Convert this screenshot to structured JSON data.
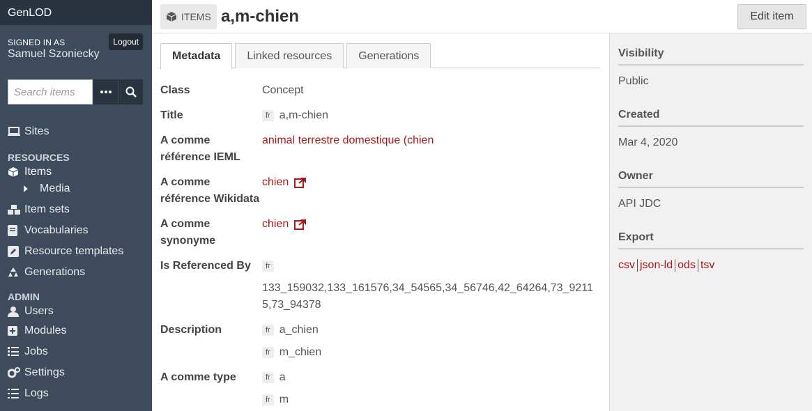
{
  "app": {
    "brand": "GenLOD"
  },
  "user": {
    "signed_in_label": "SIGNED IN AS",
    "name": "Samuel Szoniecky",
    "logout_label": "Logout"
  },
  "search": {
    "placeholder": "Search items"
  },
  "nav": {
    "sites": "Sites",
    "resources_header": "RESOURCES",
    "items": "Items",
    "media": "Media",
    "item_sets": "Item sets",
    "vocabularies": "Vocabularies",
    "resource_templates": "Resource templates",
    "generations": "Generations",
    "admin_header": "ADMIN",
    "users": "Users",
    "modules": "Modules",
    "jobs": "Jobs",
    "settings": "Settings",
    "logs": "Logs"
  },
  "header": {
    "crumb": "ITEMS",
    "title": "a,m-chien",
    "edit_label": "Edit item"
  },
  "tabs": [
    "Metadata",
    "Linked resources",
    "Generations"
  ],
  "props": {
    "class": {
      "label": "Class",
      "value": "Concept"
    },
    "title": {
      "label": "Title",
      "lang": "fr",
      "value": "a,m-chien"
    },
    "ieml": {
      "label": "A comme référence IEML",
      "value": "animal terrestre domestique (chien"
    },
    "wikidata": {
      "label": "A comme référence Wikidata",
      "value": "chien"
    },
    "synonyme": {
      "label": "A comme synonyme",
      "value": "chien"
    },
    "referenced": {
      "label": "Is Referenced By",
      "lang": "fr",
      "value": "133_159032,133_161576,34_54565,34_56746,42_64264,73_92115,73_94378"
    },
    "description": {
      "label": "Description",
      "values": [
        {
          "lang": "fr",
          "value": "a_chien"
        },
        {
          "lang": "fr",
          "value": "m_chien"
        }
      ]
    },
    "type": {
      "label": "A comme type",
      "values": [
        {
          "lang": "fr",
          "value": "a"
        },
        {
          "lang": "fr",
          "value": "m"
        }
      ]
    }
  },
  "aside": {
    "visibility_label": "Visibility",
    "visibility": "Public",
    "created_label": "Created",
    "created": "Mar 4, 2020",
    "owner_label": "Owner",
    "owner": "API JDC",
    "export_label": "Export",
    "exports": [
      "csv",
      "json-ld",
      "ods",
      "tsv"
    ]
  },
  "colors": {
    "sidebar": "#3d4b5c",
    "brand_bar": "#2a3441",
    "link": "#a91919",
    "aside_bg": "#f1f1f1"
  }
}
